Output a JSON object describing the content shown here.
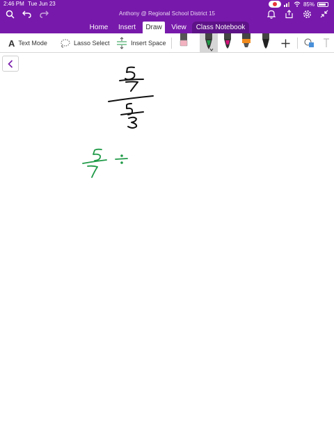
{
  "status_bar": {
    "time": "2:46 PM",
    "date": "Tue Jun 23",
    "battery": "85%",
    "battery_fraction": 0.85
  },
  "window": {
    "title": "Anthony @ Regional School District 15"
  },
  "ribbon": {
    "tabs": [
      {
        "label": "Home"
      },
      {
        "label": "Insert"
      },
      {
        "label": "Draw"
      },
      {
        "label": "View"
      },
      {
        "label": "Class Notebook"
      }
    ],
    "active_tab": "Draw"
  },
  "toolbar": {
    "text_mode": "Text Mode",
    "lasso_select": "Lasso Select",
    "insert_space": "Insert Space"
  },
  "colors": {
    "brand": "#7719aa",
    "green_ink": "#1f9a47",
    "black_ink": "#111111",
    "magenta_pen": "#d4127a",
    "orange_highlighter": "#f08a1c",
    "eraser_pink": "#f3b2c0"
  },
  "icons": [
    "search-icon",
    "undo-icon",
    "redo-icon",
    "record-icon",
    "wifi-icon",
    "battery-icon",
    "bell-icon",
    "share-icon",
    "gear-icon",
    "collapse-icon",
    "text-mode-icon",
    "lasso-icon",
    "insert-space-icon",
    "eraser-icon",
    "pen-icon",
    "highlighter-icon",
    "add-icon",
    "shapes-icon",
    "back-chevron-icon"
  ]
}
